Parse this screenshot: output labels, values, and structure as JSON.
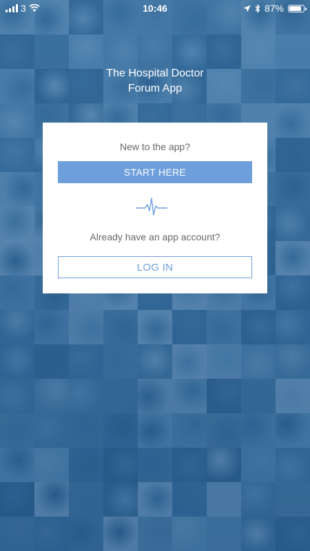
{
  "status_bar": {
    "carrier": "3",
    "time": "10:46",
    "battery_percent": "87%",
    "battery_level": 0.87,
    "icons": [
      "signal-icon",
      "wifi-icon",
      "location-arrow-icon",
      "bluetooth-icon",
      "battery-icon"
    ]
  },
  "app": {
    "title_line1": "The Hospital Doctor",
    "title_line2": "Forum App"
  },
  "card": {
    "new_prompt": "New to the app?",
    "start_label": "START HERE",
    "divider_icon": "heartbeat-pulse-icon",
    "existing_prompt": "Already have an app account?",
    "login_label": "LOG IN"
  },
  "colors": {
    "accent": "#6e9fdb",
    "background_tint": "#3d6f9c",
    "card": "#ffffff",
    "prompt_text": "#666666"
  }
}
